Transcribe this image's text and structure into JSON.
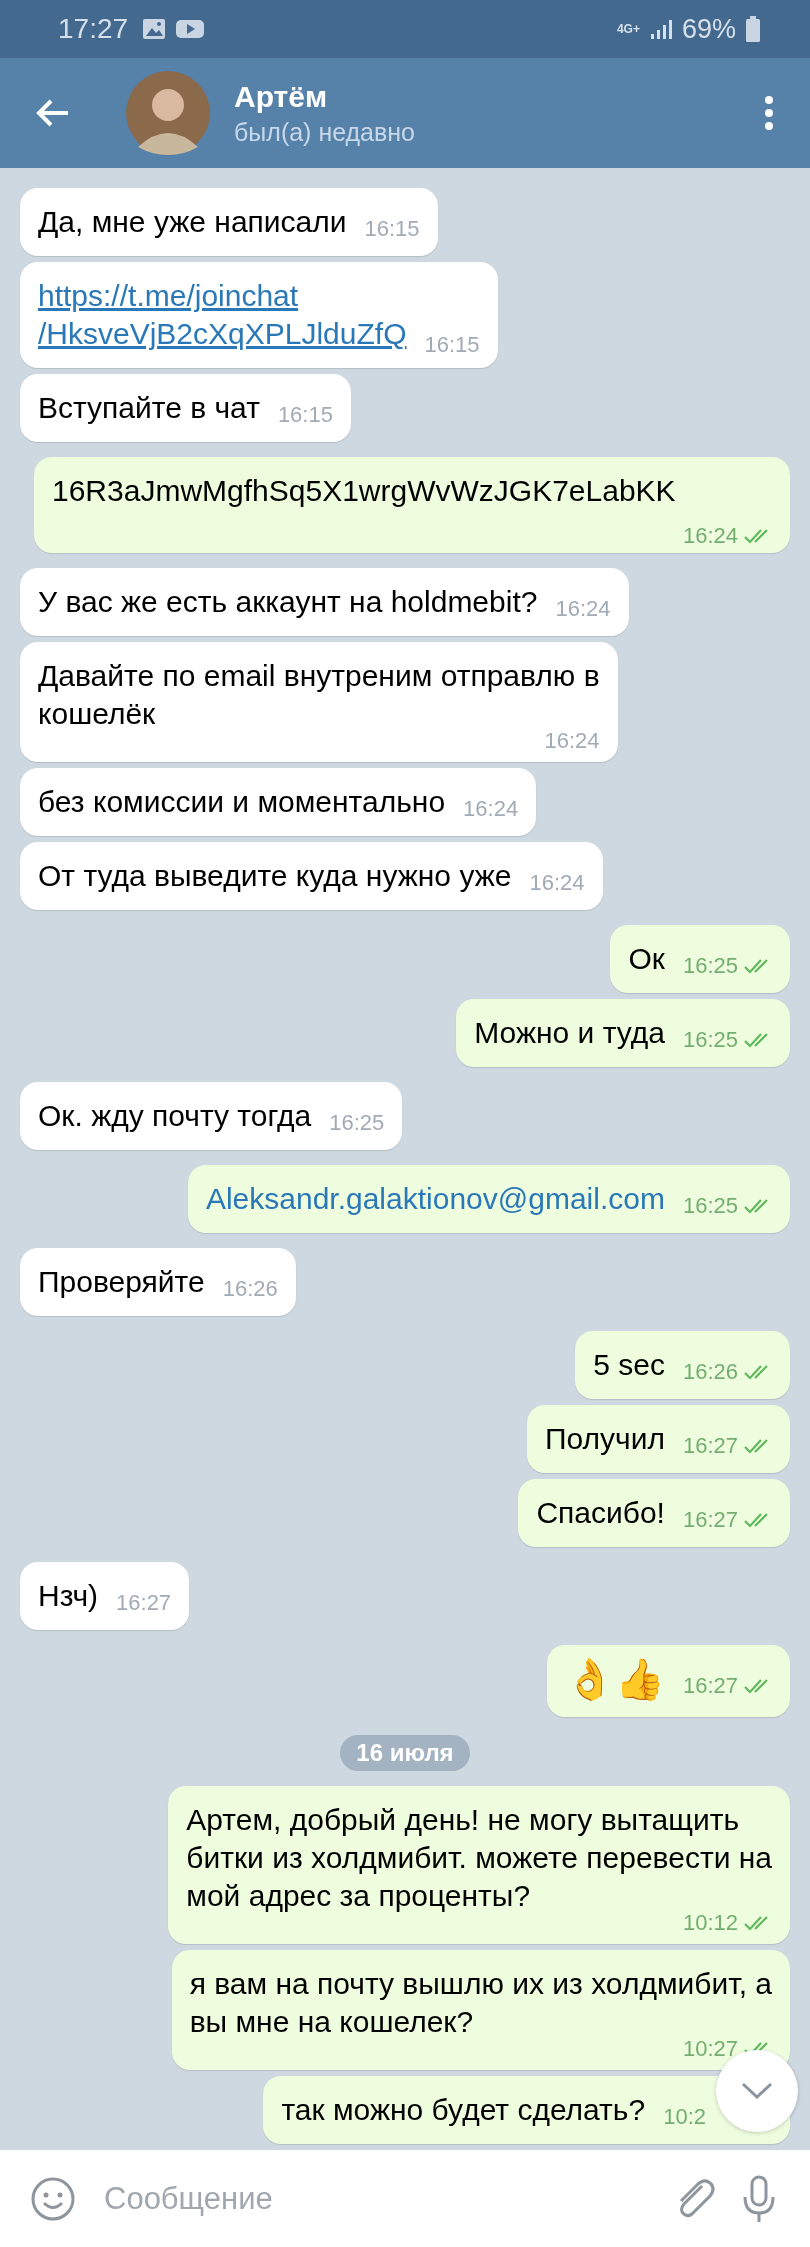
{
  "status_bar": {
    "time": "17:27",
    "network": "4G+",
    "battery": "69%"
  },
  "header": {
    "title": "Артём",
    "subtitle": "был(а) недавно"
  },
  "messages": [
    {
      "kind": "text",
      "outgoing": false,
      "text": "Да, мне уже написали",
      "time": "16:15"
    },
    {
      "kind": "link",
      "outgoing": false,
      "text": "https://t.me/joinchat\n/HksveVjB2cXqXPLJlduZfQ",
      "time": "16:15"
    },
    {
      "kind": "text",
      "outgoing": false,
      "text": "Вступайте в чат",
      "time": "16:15"
    },
    {
      "kind": "text",
      "outgoing": true,
      "text": "16R3aJmwMgfhSq5X1wrgWvWzJGK7eLabKK",
      "time": "16:24",
      "read": true
    },
    {
      "kind": "text",
      "outgoing": false,
      "text": "У вас же есть аккаунт на holdmebit?",
      "time": "16:24"
    },
    {
      "kind": "text",
      "outgoing": false,
      "text": "Давайте по email внутреним отправлю в\nкошелёк",
      "time": "16:24"
    },
    {
      "kind": "text",
      "outgoing": false,
      "text": "без комиссии и моментально",
      "time": "16:24"
    },
    {
      "kind": "text",
      "outgoing": false,
      "text": "От туда выведите куда нужно уже",
      "time": "16:24"
    },
    {
      "kind": "text",
      "outgoing": true,
      "text": "Ок",
      "time": "16:25",
      "read": true
    },
    {
      "kind": "text",
      "outgoing": true,
      "text": "Можно и туда",
      "time": "16:25",
      "read": true
    },
    {
      "kind": "text",
      "outgoing": false,
      "text": "Ок. жду почту тогда",
      "time": "16:25"
    },
    {
      "kind": "email",
      "outgoing": true,
      "text": "Aleksandr.galaktionov@gmail.com",
      "time": "16:25",
      "read": true
    },
    {
      "kind": "text",
      "outgoing": false,
      "text": "Проверяйте",
      "time": "16:26"
    },
    {
      "kind": "text",
      "outgoing": true,
      "text": "5 sec",
      "time": "16:26",
      "read": true
    },
    {
      "kind": "text",
      "outgoing": true,
      "text": "Получил",
      "time": "16:27",
      "read": true
    },
    {
      "kind": "text",
      "outgoing": true,
      "text": "Спасибо!",
      "time": "16:27",
      "read": true
    },
    {
      "kind": "text",
      "outgoing": false,
      "text": "Нзч)",
      "time": "16:27"
    },
    {
      "kind": "emoji",
      "outgoing": true,
      "text": "👌👍",
      "time": "16:27",
      "read": true
    },
    {
      "kind": "date",
      "text": "16 июля"
    },
    {
      "kind": "text",
      "outgoing": true,
      "text": "Артем, добрый день! не могу вытащить\nбитки из холдмибит. можете перевести на\nмой адрес за проценты?",
      "time": "10:12",
      "read": true
    },
    {
      "kind": "text",
      "outgoing": true,
      "text": "я вам на почту вышлю их из холдмибит, а\nвы мне на кошелек?",
      "time": "10:27",
      "read": true
    },
    {
      "kind": "text",
      "outgoing": true,
      "text": "так можно будет сделать?",
      "time": "10:2"
    }
  ],
  "input": {
    "placeholder": "Сообщение"
  }
}
